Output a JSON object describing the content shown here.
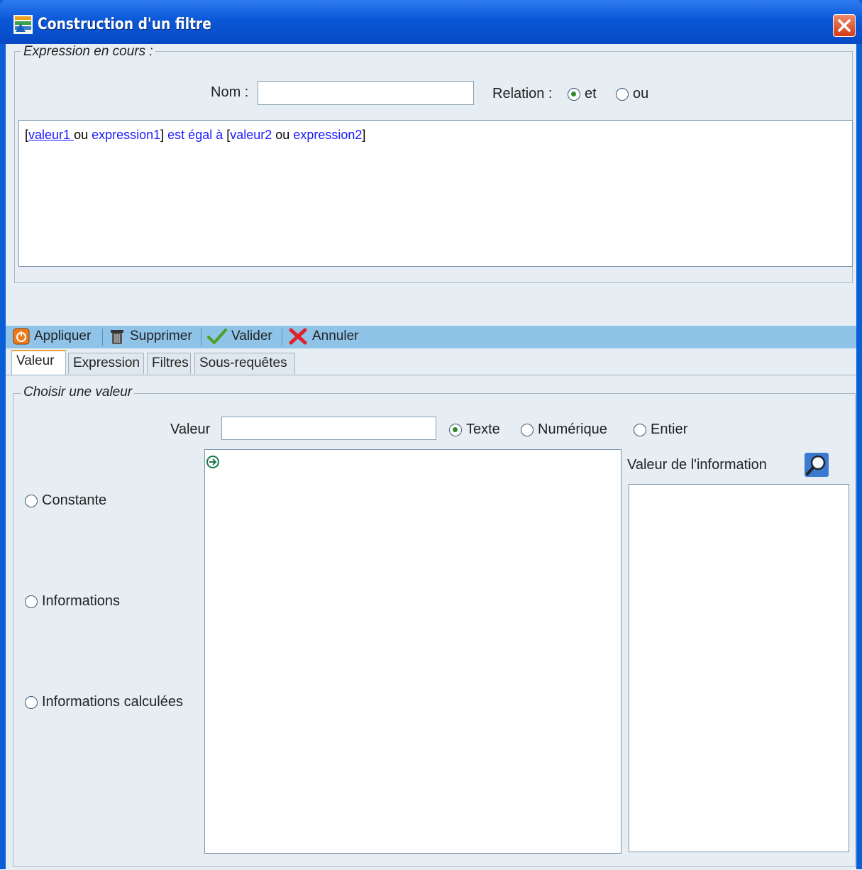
{
  "window": {
    "title": "Construction d'un filtre",
    "close_label": "✕"
  },
  "expression_group": {
    "legend": "Expression en cours :",
    "nom_label": "Nom :",
    "nom_value": "",
    "relation_label": "Relation :",
    "relation_options": [
      {
        "label": "et",
        "selected": true
      },
      {
        "label": "ou",
        "selected": false
      }
    ],
    "expression": {
      "open1": "[",
      "valeur1": "valeur1 ",
      "ou1": " ou ",
      "expression1": "expression1",
      "close1": "]",
      "operator": " est égal à ",
      "open2": "[",
      "valeur2": "valeur2",
      "ou2": " ou ",
      "expression2": "expression2",
      "close2": "]"
    }
  },
  "toolbar": {
    "appliquer": "Appliquer",
    "supprimer": "Supprimer",
    "valider": "Valider",
    "annuler": "Annuler"
  },
  "tabs": [
    {
      "label": "Valeur",
      "active": true
    },
    {
      "label": "Expression",
      "active": false
    },
    {
      "label": "Filtres",
      "active": false
    },
    {
      "label": "Sous-requêtes",
      "active": false
    }
  ],
  "valeur_group": {
    "legend": "Choisir une valeur",
    "valeur_label": "Valeur",
    "valeur_value": "",
    "type_options": [
      {
        "label": "Texte",
        "selected": true
      },
      {
        "label": "Numérique",
        "selected": false
      },
      {
        "label": "Entier",
        "selected": false
      }
    ],
    "source_options": [
      {
        "label": "Constante",
        "selected": false
      },
      {
        "label": "Informations",
        "selected": false
      },
      {
        "label": "Informations calculées",
        "selected": false
      }
    ],
    "info_value_label": "Valeur de l'information"
  },
  "colors": {
    "titlebar": "#0a58d8",
    "toolbar": "#8fc3e8",
    "client": "#e6eef3",
    "link": "#1a1aff"
  }
}
